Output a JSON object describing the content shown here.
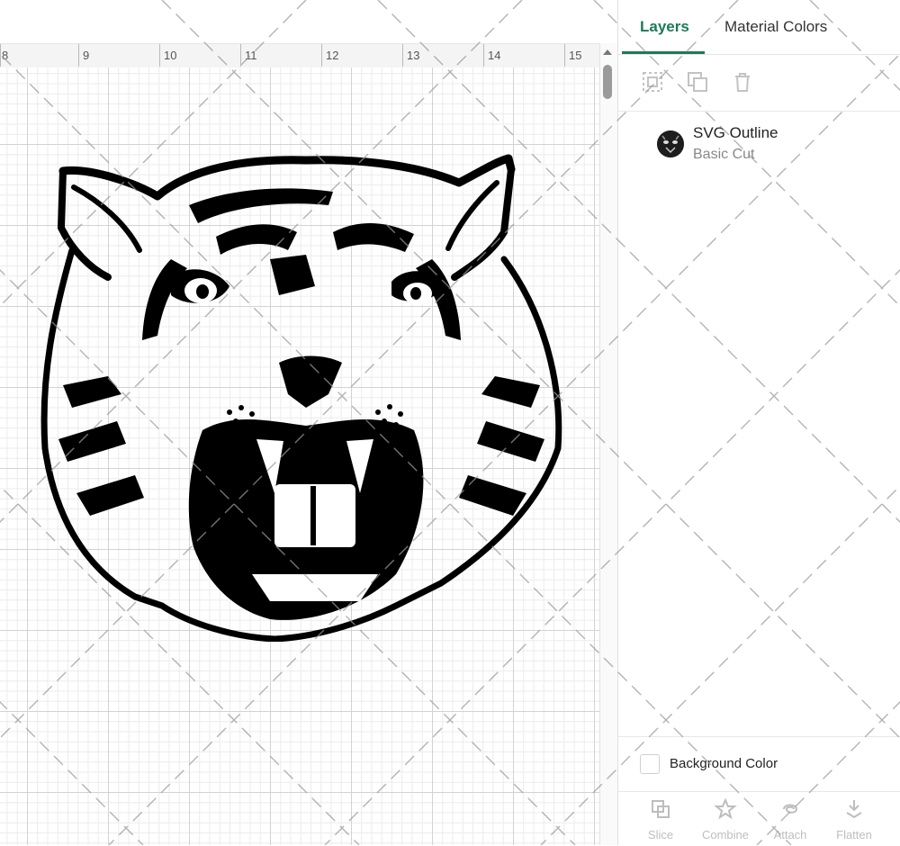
{
  "ruler": {
    "labels": [
      "8",
      "9",
      "10",
      "11",
      "12",
      "13",
      "14",
      "15"
    ]
  },
  "canvas": {
    "artwork": "tiger-head-outline"
  },
  "tabs": {
    "layers": "Layers",
    "material_colors": "Material Colors"
  },
  "layer_toolbar": {
    "icons": [
      "group-icon",
      "duplicate-icon",
      "delete-icon"
    ]
  },
  "layer": {
    "name": "SVG Outline",
    "subtitle": "Basic Cut"
  },
  "background": {
    "label": "Background Color",
    "checked": false
  },
  "bottom_toolbar": {
    "slice": "Slice",
    "combine": "Combine",
    "attach": "Attach",
    "flatten": "Flatten"
  },
  "colors": {
    "accent": "#1b7a57",
    "artwork": "#000000",
    "grid": "#d2d2d2"
  }
}
